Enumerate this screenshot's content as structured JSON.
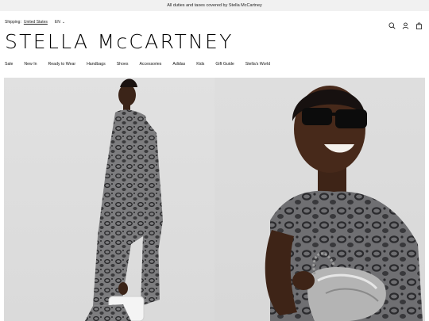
{
  "announcement": "All duties and taxes covered by Stella McCartney",
  "shipping": {
    "label": "Shipping:",
    "country": "United States",
    "language": "EN"
  },
  "header_icons": [
    "search-icon",
    "account-icon",
    "bag-icon"
  ],
  "logo": "STELLA McCARTNEY",
  "nav": [
    "Sale",
    "New In",
    "Ready to Wear",
    "Handbags",
    "Shoes",
    "Accessories",
    "Adidas",
    "Kids",
    "Gift Guide",
    "Stella's World"
  ],
  "colors": {
    "announce_bg": "#f1f1f1",
    "hero_bg": "#dcdcdc",
    "text": "#111111"
  }
}
